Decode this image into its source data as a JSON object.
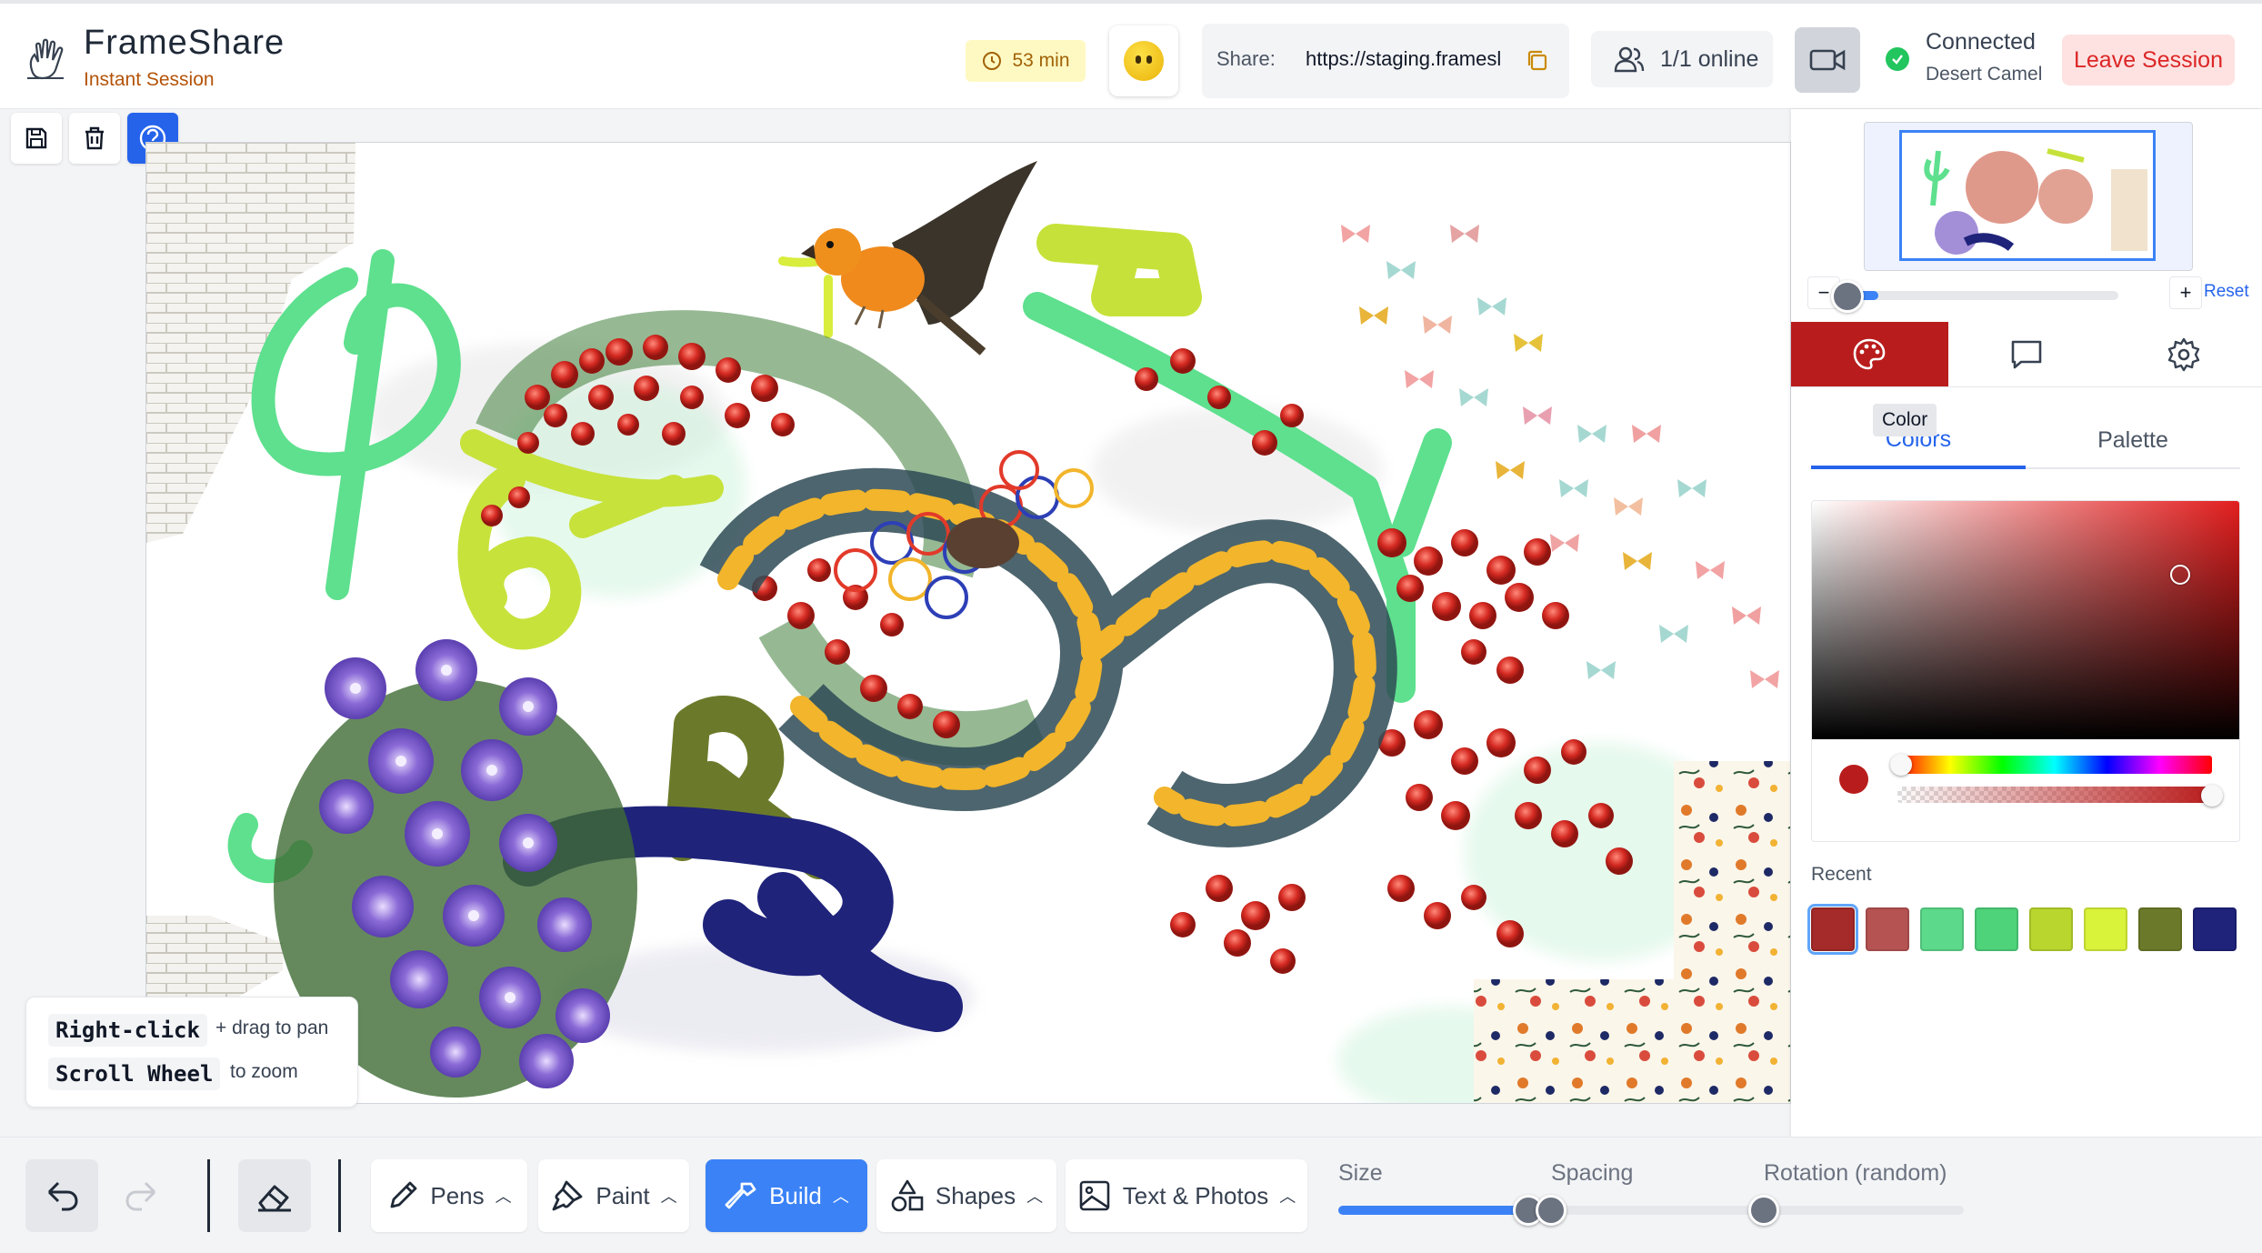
{
  "header": {
    "app_title": "FrameShare",
    "app_subtitle": "Instant Session",
    "timer": "53 min",
    "share_label": "Share:",
    "share_url": "https://staging.framesl",
    "online_count": "1/1 online",
    "connection_status": "Connected",
    "user_name": "Desert Camel",
    "leave_label": "Leave Session"
  },
  "hints": {
    "pan_key": "Right-click",
    "pan_text": "+ drag to pan",
    "zoom_key": "Scroll Wheel",
    "zoom_text": "to zoom"
  },
  "panel": {
    "zoom_minus": "−",
    "zoom_plus": "+",
    "zoom_reset": "Reset",
    "tooltip": "Color",
    "subtabs": [
      "Colors",
      "Palette"
    ],
    "recent_label": "Recent",
    "recent_colors": [
      "#a52a2a",
      "#b55252",
      "#5cd98a",
      "#4ed27a",
      "#b8d62d",
      "#d9f23a",
      "#6b7a2a",
      "#1f237a"
    ],
    "current_color": "#b91c1c",
    "zoom_level": 0.08,
    "hue_level": 0.0,
    "alpha_level": 1.0
  },
  "toolbar": {
    "pens": "Pens",
    "paint": "Paint",
    "build": "Build",
    "shapes": "Shapes",
    "text_photos": "Text & Photos",
    "size_label": "Size",
    "spacing_label": "Spacing",
    "rotation_label": "Rotation (random)",
    "size_value": 0.95,
    "spacing_value": 0.0,
    "rotation_value": 0.0
  },
  "colors": {
    "accent": "#2563eb",
    "active_tab": "#b91c1c",
    "leave_bg": "#fee2e2",
    "leave_text": "#dc2626"
  }
}
